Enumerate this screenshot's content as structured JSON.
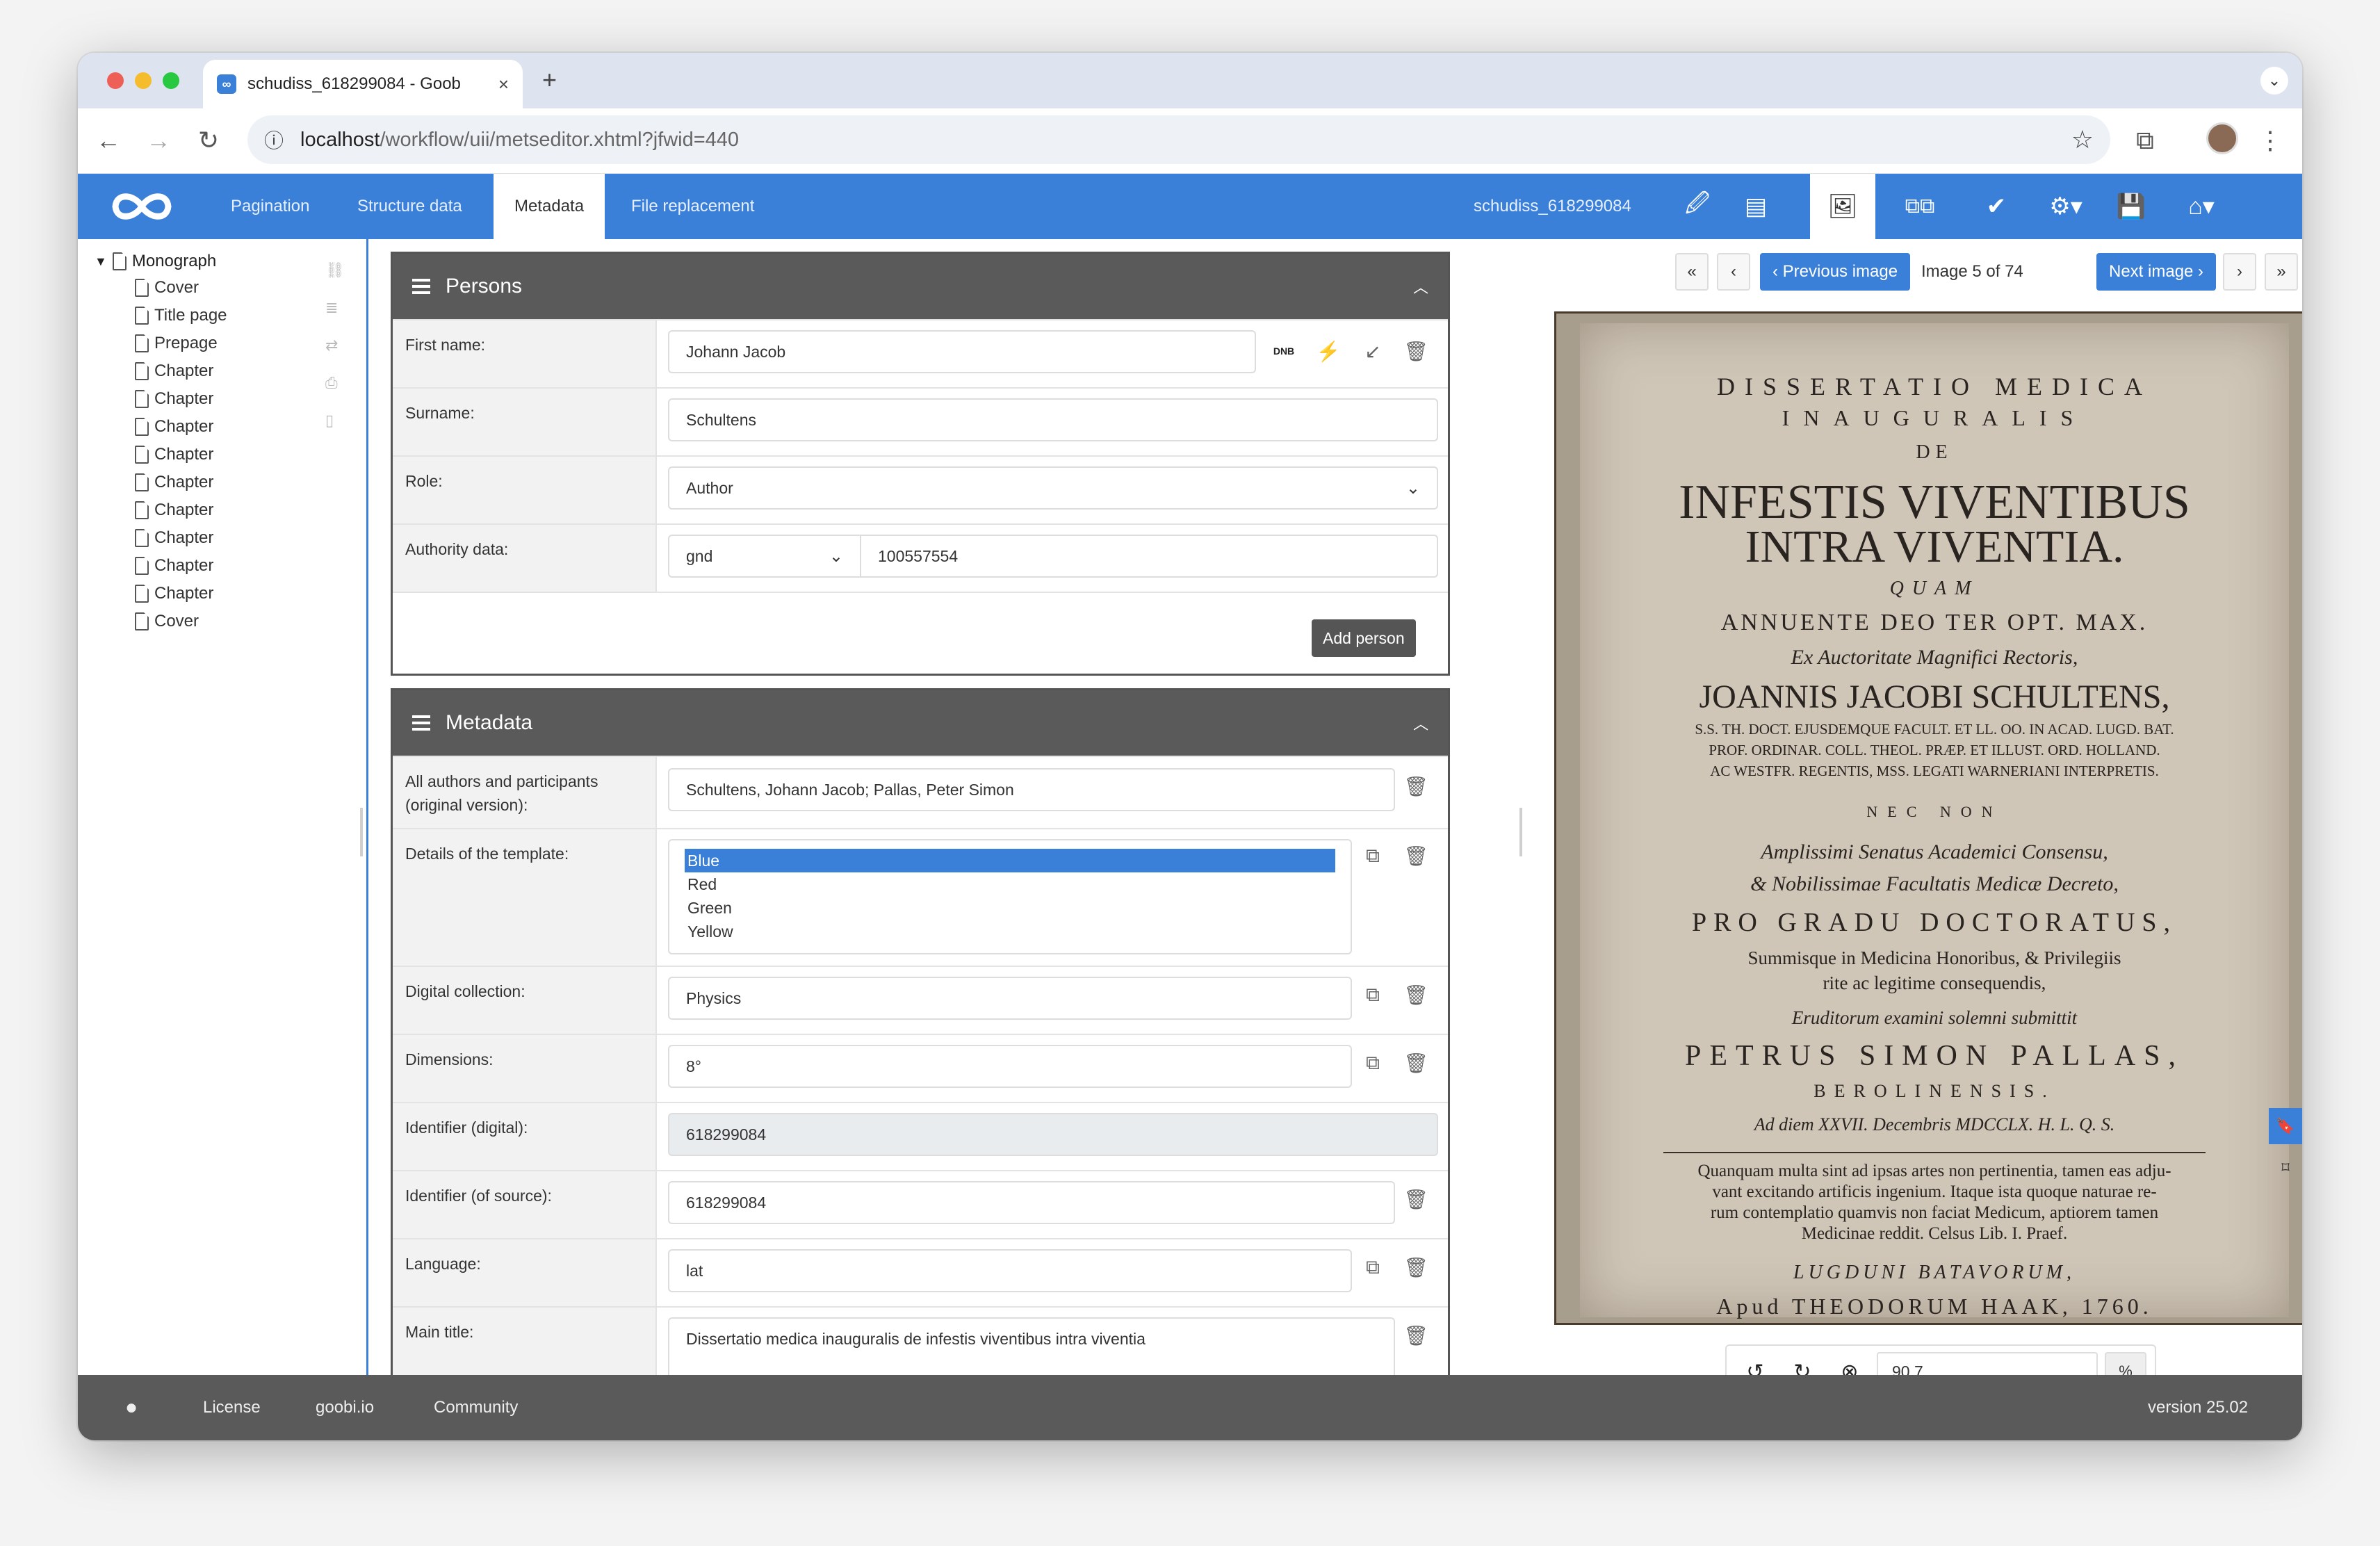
{
  "browser": {
    "tab_title": "schudiss_618299084 - Goob",
    "favicon": "∞",
    "url_host": "localhost",
    "url_path": "/workflow/uii/metseditor.xhtml?jfwid=440"
  },
  "appnav": {
    "tabs": [
      "Pagination",
      "Structure data",
      "Metadata",
      "File replacement"
    ],
    "active_tab": "Metadata",
    "document_id": "schudiss_618299084"
  },
  "tree": {
    "root": "Monograph",
    "items": [
      "Cover",
      "Title page",
      "Prepage",
      "Chapter",
      "Chapter",
      "Chapter",
      "Chapter",
      "Chapter",
      "Chapter",
      "Chapter",
      "Chapter",
      "Chapter",
      "Cover"
    ]
  },
  "persons": {
    "title": "Persons",
    "first_name_label": "First name:",
    "first_name_value": "Johann Jacob",
    "surname_label": "Surname:",
    "surname_value": "Schultens",
    "role_label": "Role:",
    "role_value": "Author",
    "authority_label": "Authority data:",
    "authority_source": "gnd",
    "authority_value": "100557554",
    "add_button": "Add person",
    "dnb_badge": "DNB"
  },
  "metadata": {
    "title": "Metadata",
    "authors_label": "All authors and participants (original version):",
    "authors_value": "Schultens, Johann Jacob; Pallas, Peter Simon",
    "template_label": "Details of the template:",
    "template_options": [
      "Blue",
      "Red",
      "Green",
      "Yellow"
    ],
    "template_selected": "Blue",
    "collection_label": "Digital collection:",
    "collection_value": "Physics",
    "dimensions_label": "Dimensions:",
    "dimensions_value": "8°",
    "id_digital_label": "Identifier (digital):",
    "id_digital_value": "618299084",
    "id_source_label": "Identifier (of source):",
    "id_source_value": "618299084",
    "language_label": "Language:",
    "language_value": "lat",
    "main_title_label": "Main title:",
    "main_title_value": "Dissertatio medica inauguralis de infestis viventibus intra viventia"
  },
  "viewer": {
    "prev_label": "‹ Previous image",
    "next_label": "Next image ›",
    "image_counter": "Image 5 of 74",
    "zoom_value": "90.7",
    "zoom_unit": "%",
    "scan_lines": [
      "DISSERTATIO MEDICA",
      "INAUGURALIS",
      "DE",
      "INFESTIS VIVENTIBUS",
      "INTRA VIVENTIA.",
      "QUAM",
      "ANNUENTE DEO TER OPT. MAX.",
      "Ex Auctoritate Magnifici Rectoris,",
      "JOANNIS JACOBI SCHULTENS,",
      "S.S. TH. DOCT. EJUSDEMQUE FACULT. ET LL. OO. IN ACAD. LUGD. BAT.",
      "PROF. ORDINAR. COLL. THEOL. PRÆP. ET ILLUST. ORD. HOLLAND.",
      "AC WESTFR. REGENTIS, MSS. LEGATI WARNERIANI INTERPRETIS.",
      "NEC NON",
      "Amplissimi Senatus Academici Consensu,",
      "& Nobilissimae Facultatis Medicæ Decreto,",
      "PRO GRADU DOCTORATUS,",
      "Summisque in Medicina Honoribus, & Privilegiis",
      "rite ac legitime consequendis,",
      "Eruditorum examini solemni submittit",
      "PETRUS SIMON PALLAS,",
      "BEROLINENSIS.",
      "Ad diem XXVII. Decembris MDCCLX. H. L. Q. S.",
      "Quanquam multa sint ad ipsas artes non pertinentia, tamen eas adju-",
      "vant excitando artificis ingenium. Itaque ista quoque naturae re-",
      "rum contemplatio quamvis non faciat Medicum, aptiorem tamen",
      "Medicinae reddit. Celsus Lib. I. Praef.",
      "LUGDUNI BATAVORUM,",
      "Apud THEODORUM HAAK, 1760."
    ]
  },
  "footer": {
    "license": "License",
    "site": "goobi.io",
    "community": "Community",
    "version": "version 25.02"
  },
  "colors": {
    "accent": "#3a7fd8",
    "header_dark": "#5a5a5a",
    "footer": "#5a5a5a"
  }
}
